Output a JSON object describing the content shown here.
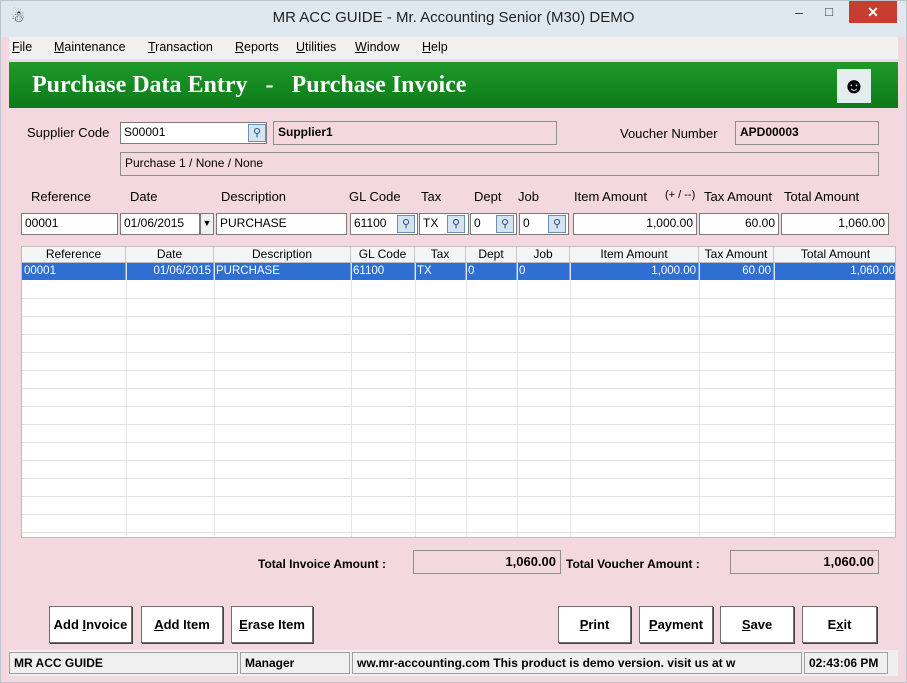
{
  "window": {
    "title": "MR ACC GUIDE - Mr. Accounting Senior (M30) DEMO",
    "app_icon": "person-icon",
    "minimize_label": "–",
    "maximize_label": "□",
    "close_label": "✕"
  },
  "menu": {
    "items": [
      {
        "mn": "F",
        "rest": "ile"
      },
      {
        "mn": "",
        "rest": "Maintenance",
        "pre": "M"
      },
      {
        "mn": "T",
        "rest": "ransaction"
      },
      {
        "mn": "R",
        "rest": "eports"
      },
      {
        "mn": "U",
        "rest": "tilities"
      },
      {
        "mn": "W",
        "rest": "indow"
      },
      {
        "mn": "H",
        "rest": "elp"
      }
    ]
  },
  "header": {
    "title": "Purchase Data Entry   -   Purchase Invoice",
    "icon": "reader-icon"
  },
  "form": {
    "supplier_code_label": "Supplier Code",
    "supplier_code": "S00001",
    "supplier_name": "Supplier1",
    "voucher_number_label": "Voucher Number",
    "voucher_number": "APD00003",
    "supplier_detail": "Purchase 1 / None / None"
  },
  "entry": {
    "labels": {
      "reference": "Reference",
      "date": "Date",
      "description": "Description",
      "gl_code": "GL Code",
      "tax": "Tax",
      "dept": "Dept",
      "job": "Job",
      "item_amount": "Item Amount",
      "item_amount_hint": "(+ / --)",
      "tax_amount": "Tax Amount",
      "total_amount": "Total Amount"
    },
    "values": {
      "reference": "00001",
      "date": "01/06/2015",
      "description": "PURCHASE",
      "gl_code": "61100",
      "tax": "TX",
      "dept": "0",
      "job": "0",
      "item_amount": "1,000.00",
      "tax_amount": "60.00",
      "total_amount": "1,060.00"
    }
  },
  "grid": {
    "columns": [
      "Reference",
      "Date",
      "Description",
      "GL Code",
      "Tax",
      "Dept",
      "Job",
      "Item Amount",
      "Tax Amount",
      "Total Amount"
    ],
    "rows": [
      [
        "00001",
        "01/06/2015",
        "PURCHASE",
        "61100",
        "TX",
        "0",
        "0",
        "1,000.00",
        "60.00",
        "1,060.00"
      ]
    ]
  },
  "totals": {
    "invoice_label": "Total Invoice Amount :",
    "invoice_value": "1,060.00",
    "voucher_label": "Total  Voucher Amount :",
    "voucher_value": "1,060.00"
  },
  "buttons": {
    "add_invoice": {
      "pre": "Add ",
      "mn": "I",
      "rest": "nvoice"
    },
    "add_item": {
      "pre": "",
      "mn": "A",
      "rest": "dd Item"
    },
    "erase_item": {
      "pre": "",
      "mn": "E",
      "rest": "rase Item"
    },
    "print": {
      "pre": "",
      "mn": "P",
      "rest": "rint"
    },
    "payment": {
      "pre": "",
      "mn": "P",
      "rest": "ayment"
    },
    "save": {
      "pre": "",
      "mn": "S",
      "rest": "ave"
    },
    "exit": {
      "pre": "E",
      "mn": "x",
      "rest": "it"
    }
  },
  "status": {
    "company": "MR ACC GUIDE",
    "user": "Manager",
    "message": "ww.mr-accounting.com This product is demo version.  visit us at w",
    "time": "02:43:06 PM"
  }
}
